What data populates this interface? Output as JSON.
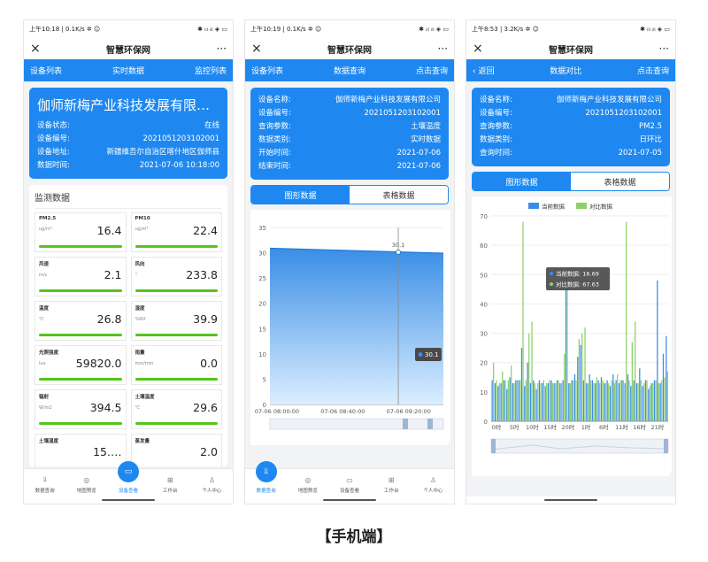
{
  "app_title": "智慧环保网",
  "close_icon": "×",
  "more_icon": "···",
  "caption": "【手机端】",
  "nav": [
    {
      "label": "数据查询",
      "icon": "chart-icon"
    },
    {
      "label": "地图预览",
      "icon": "map-pin-icon"
    },
    {
      "label": "设备查看",
      "icon": "monitor-icon"
    },
    {
      "label": "工作台",
      "icon": "grid-icon"
    },
    {
      "label": "个人中心",
      "icon": "user-icon"
    }
  ],
  "colors": {
    "primary": "#1e88f0",
    "green": "#52c41a",
    "series_current": "#3a8ee6",
    "series_compare": "#8fd06b"
  },
  "p1": {
    "status_left": "上午10:18 | 0.1K/s ✲ ☺",
    "status_right": "✱ ᵢₗₗ ᵢₗₗ ◈ ▭",
    "bar": {
      "left": "设备列表",
      "center": "实时数据",
      "right": "监控列表"
    },
    "company": "伽师新梅产业科技发展有限…",
    "info": [
      {
        "k": "设备状态:",
        "v": "在线"
      },
      {
        "k": "设备编号:",
        "v": "2021051203102001"
      },
      {
        "k": "设备地址:",
        "v": "新疆维吾尔自治区喀什地区伽师县"
      },
      {
        "k": "数据时间:",
        "v": "2021-07-06 10:18:00"
      }
    ],
    "monitor_title": "监测数据",
    "tiles": [
      {
        "name": "PM2.5",
        "unit": "ug/m³",
        "value": "16.4"
      },
      {
        "name": "PM10",
        "unit": "ug/m³",
        "value": "22.4"
      },
      {
        "name": "风速",
        "unit": "m/s",
        "value": "2.1"
      },
      {
        "name": "风向",
        "unit": "°",
        "value": "233.8"
      },
      {
        "name": "温度",
        "unit": "℃",
        "value": "26.8"
      },
      {
        "name": "湿度",
        "unit": "%RH",
        "value": "39.9"
      },
      {
        "name": "光照强度",
        "unit": "lux",
        "value": "59820.0"
      },
      {
        "name": "雨量",
        "unit": "mm/min",
        "value": "0.0"
      },
      {
        "name": "辐射",
        "unit": "W/m2",
        "value": "394.5"
      },
      {
        "name": "土壤温度",
        "unit": "℃",
        "value": "29.6"
      },
      {
        "name": "土壤湿度",
        "unit": "",
        "value": "15.…"
      },
      {
        "name": "蒸发量",
        "unit": "",
        "value": "2.0"
      }
    ],
    "active_nav": 2
  },
  "p2": {
    "status_left": "上午10:19 | 0.1K/s ✲ ☺",
    "status_right": "✱ ᵢₗₗ ᵢₗₗ ◈ ▭",
    "bar": {
      "left": "设备列表",
      "center": "数据查询",
      "right": "点击查询"
    },
    "info": [
      {
        "k": "设备名称:",
        "v": "伽师新梅产业科技发展有限公司"
      },
      {
        "k": "设备编号:",
        "v": "2021051203102001"
      },
      {
        "k": "查询参数:",
        "v": "土壤温度"
      },
      {
        "k": "数据类别:",
        "v": "实时数据"
      },
      {
        "k": "开始时间:",
        "v": "2021-07-06"
      },
      {
        "k": "结束时间:",
        "v": "2021-07-06"
      }
    ],
    "tabs": [
      "图形数据",
      "表格数据"
    ],
    "tooltip_value": "30.1",
    "point_label": "30.1",
    "active_nav": 0
  },
  "p3": {
    "status_left": "上午8:53 | 3.2K/s ✲ ☺",
    "status_right": "✱ ᵢₗₗ ᵢₗₗ ◈ ▭",
    "bar": {
      "left": "‹ 返回",
      "center": "数据对比",
      "right": "点击查询"
    },
    "info": [
      {
        "k": "设备名称:",
        "v": "伽师新梅产业科技发展有限公司"
      },
      {
        "k": "设备编号:",
        "v": "2021051203102001"
      },
      {
        "k": "查询参数:",
        "v": "PM2.5"
      },
      {
        "k": "数据类别:",
        "v": "日环比"
      },
      {
        "k": "查询时间:",
        "v": "2021-07-05"
      }
    ],
    "tabs": [
      "图形数据",
      "表格数据"
    ],
    "tooltip": [
      "当前数据: 16.69",
      "对比数据: 67.63"
    ]
  },
  "chart_data": [
    {
      "type": "area",
      "x_ticks": [
        "07-06 08:00:00",
        "07-06 08:40:00",
        "07-06 09:20:00"
      ],
      "y_ticks": [
        "0",
        "5",
        "10",
        "15",
        "20",
        "25",
        "30",
        "35"
      ],
      "ylim": [
        0,
        35
      ],
      "series": [
        {
          "values": [
            30.9,
            30.7,
            30.5,
            30.3,
            30.1,
            29.9
          ]
        }
      ],
      "annotations": [
        "30.1"
      ]
    },
    {
      "type": "bar",
      "legend": [
        "当前数据",
        "对比数据"
      ],
      "y_ticks": [
        "0",
        "10",
        "20",
        "30",
        "40",
        "50",
        "60",
        "70"
      ],
      "ylim": [
        0,
        70
      ],
      "categories": [
        "0时",
        "5时",
        "10时",
        "15时",
        "20时",
        "1时",
        "6时",
        "11时",
        "16时",
        "21时"
      ],
      "series": [
        {
          "name": "当前数据",
          "values": [
            14,
            13,
            12,
            13,
            14,
            11,
            15,
            13,
            14,
            14,
            25,
            12,
            20,
            13,
            14,
            11,
            14,
            13,
            12,
            13,
            14,
            13,
            14,
            13,
            14,
            45,
            13,
            14,
            16,
            22,
            26,
            14,
            13,
            16,
            14,
            13,
            14,
            15,
            13,
            14,
            12,
            16,
            14,
            13,
            14,
            13,
            16,
            12,
            14,
            13,
            18,
            12,
            14,
            11,
            13,
            14,
            48,
            13,
            23,
            29
          ]
        },
        {
          "name": "对比数据",
          "values": [
            20,
            14,
            13,
            17,
            14,
            14,
            19,
            13,
            14,
            14,
            68,
            14,
            30,
            34,
            13,
            13,
            13,
            14,
            13,
            14,
            13,
            13,
            14,
            13,
            23,
            45,
            13,
            14,
            14,
            28,
            30,
            32,
            13,
            14,
            13,
            15,
            13,
            14,
            13,
            13,
            14,
            13,
            16,
            14,
            14,
            68,
            14,
            27,
            34,
            13,
            14,
            13,
            14,
            12,
            13,
            14,
            13,
            14,
            15,
            17
          ]
        }
      ],
      "tooltip": {
        "current": 16.69,
        "compare": 67.63
      }
    }
  ]
}
